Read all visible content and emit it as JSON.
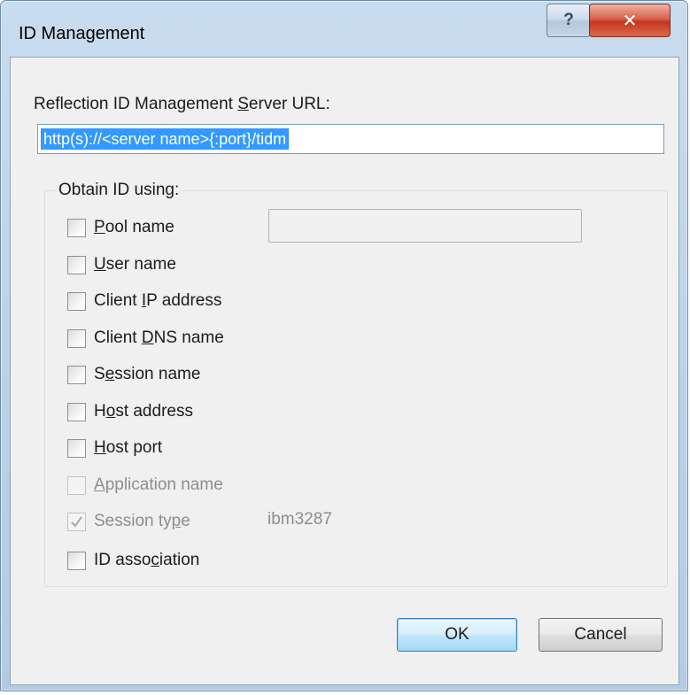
{
  "window": {
    "title": "ID Management",
    "help_symbol": "?",
    "close_symbol": "✕"
  },
  "server": {
    "label_pre": "Reflection ID Management ",
    "label_accel": "S",
    "label_post": "erver URL:",
    "url_value": "http(s)://<server name>{:port}/tidm"
  },
  "obtain": {
    "group_label": "Obtain ID using:",
    "pool_value": "",
    "options": [
      {
        "pre": "",
        "accel": "P",
        "post": "ool name",
        "checked": false,
        "disabled": false
      },
      {
        "pre": "",
        "accel": "U",
        "post": "ser name",
        "checked": false,
        "disabled": false
      },
      {
        "pre": "Client ",
        "accel": "I",
        "post": "P address",
        "checked": false,
        "disabled": false
      },
      {
        "pre": "Client ",
        "accel": "D",
        "post": "NS name",
        "checked": false,
        "disabled": false
      },
      {
        "pre": "S",
        "accel": "e",
        "post": "ssion name",
        "checked": false,
        "disabled": false
      },
      {
        "pre": "H",
        "accel": "o",
        "post": "st address",
        "checked": false,
        "disabled": false
      },
      {
        "pre": "",
        "accel": "H",
        "post": "ost port",
        "checked": false,
        "disabled": false
      },
      {
        "pre": "",
        "accel": "A",
        "post": "pplication name",
        "checked": false,
        "disabled": true
      },
      {
        "pre": "Session ty",
        "accel": "p",
        "post": "e",
        "checked": true,
        "disabled": true
      },
      {
        "pre": "ID asso",
        "accel": "c",
        "post": "iation",
        "checked": false,
        "disabled": false
      }
    ],
    "session_type_value": "ibm3287"
  },
  "buttons": {
    "ok_label": "OK",
    "cancel_label": "Cancel"
  }
}
